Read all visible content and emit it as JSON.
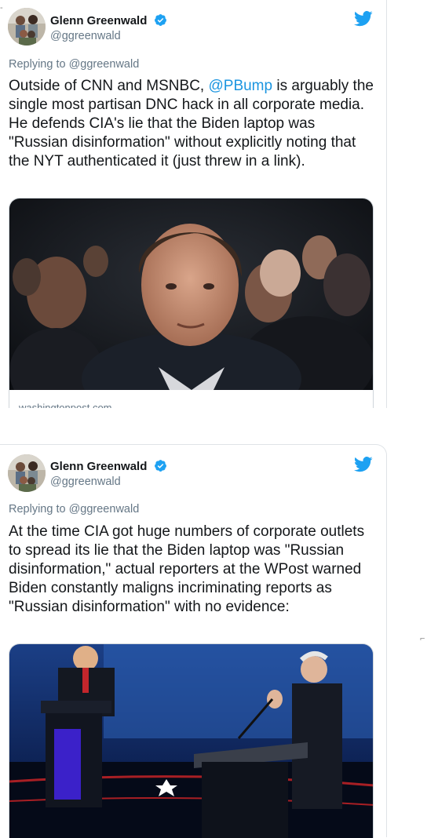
{
  "tweets": [
    {
      "author_name": "Glenn Greenwald",
      "handle": "@ggreenwald",
      "replying_to": "Replying to @ggreenwald",
      "text_before_mention": "Outside of CNN and MSNBC, ",
      "mention": "@PBump",
      "text_after_mention": " is arguably the single most partisan DNC hack in all corporate media. He defends CIA's lie that the Biden laptop was \"Russian disinformation\" without explicitly noting that the NYT authenticated it (just threw in a link).",
      "link_domain": "washingtonpost.com"
    },
    {
      "author_name": "Glenn Greenwald",
      "handle": "@ggreenwald",
      "replying_to": "Replying to @ggreenwald",
      "text": "At the time CIA got huge numbers of corporate outlets to spread its lie that the Biden laptop was \"Russian disinformation,\" actual reporters at the WPost warned Biden constantly maligns incriminating reports as \"Russian disinformation\" with no evidence:"
    }
  ],
  "icons": {
    "verified": "verified-badge-icon",
    "twitter": "twitter-bird-icon"
  },
  "colors": {
    "brand_blue": "#1da1f2",
    "link_blue": "#1b95e0",
    "secondary_text": "#657786",
    "primary_text": "#14171a"
  }
}
